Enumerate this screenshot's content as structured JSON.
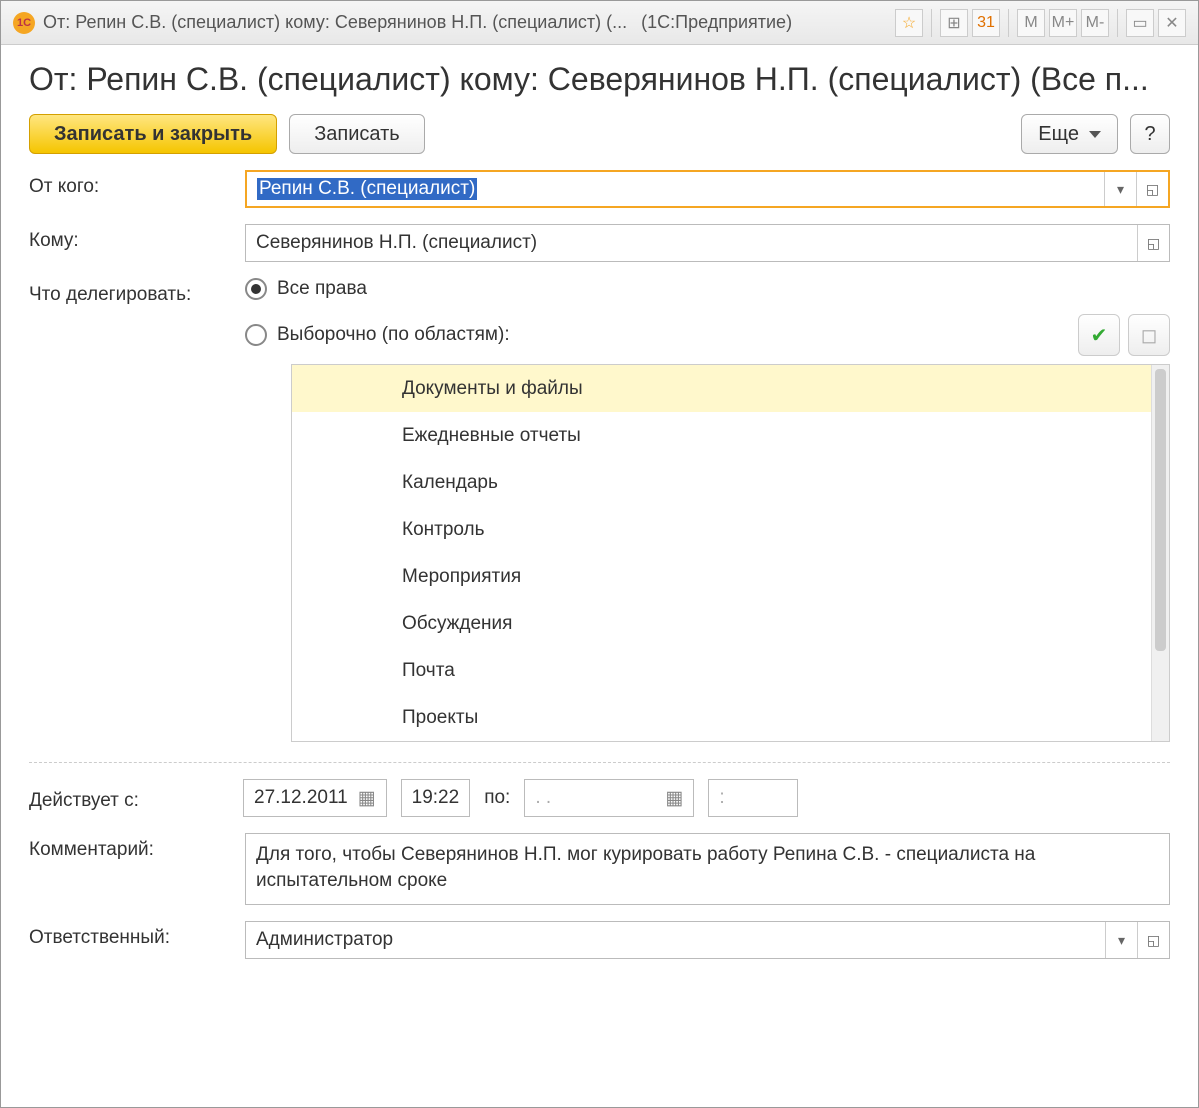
{
  "window": {
    "title": "От: Репин С.В. (специалист) кому: Северянинов Н.П. (специалист) (...",
    "app_suffix": "(1С:Предприятие)"
  },
  "page": {
    "title": "От: Репин С.В. (специалист) кому: Северянинов Н.П. (специалист) (Все п..."
  },
  "toolbar": {
    "save_close": "Записать и закрыть",
    "save": "Записать",
    "more": "Еще",
    "help": "?"
  },
  "form": {
    "from_label": "От кого:",
    "from_value": "Репин С.В. (специалист)",
    "to_label": "Кому:",
    "to_value": "Северянинов Н.П. (специалист)",
    "delegate_label": "Что делегировать:",
    "radio_all": "Все права",
    "radio_selective": "Выборочно (по областям):",
    "areas": [
      "Документы и файлы",
      "Ежедневные отчеты",
      "Календарь",
      "Контроль",
      "Мероприятия",
      "Обсуждения",
      "Почта",
      "Проекты"
    ],
    "valid_from_label": "Действует с:",
    "date_from": "27.12.2011",
    "time_from": "19:22",
    "to_label2": "по:",
    "date_to": ".  .",
    "time_to": ":",
    "comment_label": "Комментарий:",
    "comment_value": "Для того, чтобы Северянинов Н.П. мог курировать работу Репина С.В. - специалиста на испытательном сроке",
    "responsible_label": "Ответственный:",
    "responsible_value": "Администратор"
  },
  "title_icons": {
    "m": "M",
    "mplus": "M+",
    "mminus": "M-"
  }
}
